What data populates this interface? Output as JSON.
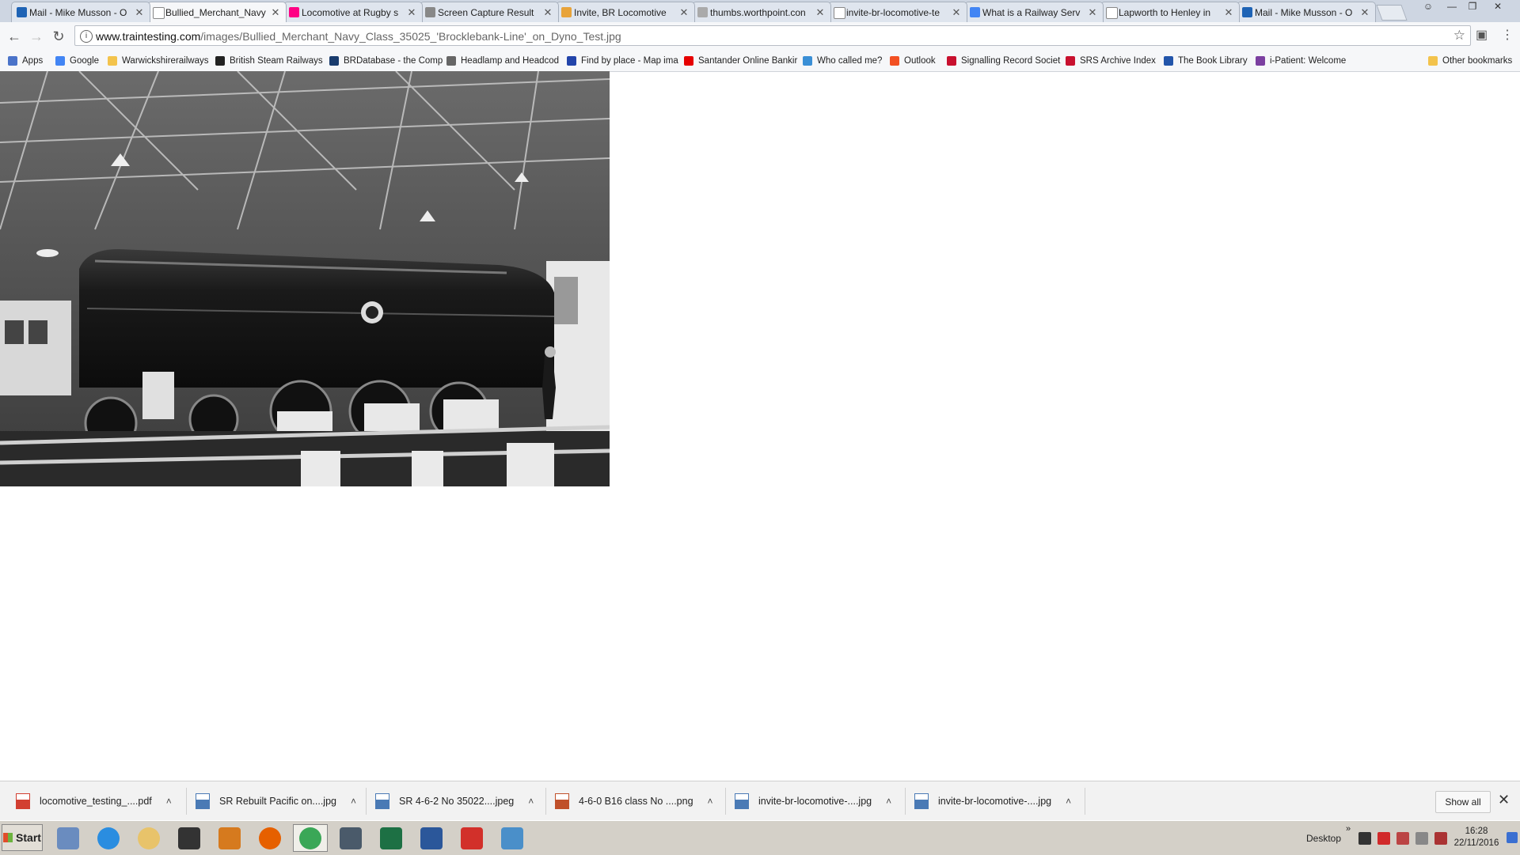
{
  "tabs": [
    {
      "title": "Mail - Mike Musson - O",
      "icon": "outlook-icon",
      "color": "#1e63b5"
    },
    {
      "title": "Bullied_Merchant_Navy",
      "icon": "page-icon",
      "color": "#ffffff",
      "active": true
    },
    {
      "title": "Locomotive at Rugby s",
      "icon": "flickr-icon",
      "color": "#ff0084"
    },
    {
      "title": "Screen Capture Result",
      "icon": "camera-icon",
      "color": "#888888"
    },
    {
      "title": "Invite, BR Locomotive",
      "icon": "site-icon",
      "color": "#e8a33a"
    },
    {
      "title": "thumbs.worthpoint.con",
      "icon": "loading-icon",
      "color": "#aaaaaa"
    },
    {
      "title": "invite-br-locomotive-te",
      "icon": "page-icon",
      "color": "#ffffff"
    },
    {
      "title": "What is a Railway Serv",
      "icon": "google-icon",
      "color": "#4285f4"
    },
    {
      "title": "Lapworth to Henley in",
      "icon": "page-icon",
      "color": "#ffffff"
    },
    {
      "title": "Mail - Mike Musson - O",
      "icon": "outlook-icon",
      "color": "#1e63b5"
    }
  ],
  "toolbar": {
    "url_host": "www.traintesting.com",
    "url_path": "/images/Bullied_Merchant_Navy_Class_35025_'Brocklebank-Line'_on_Dyno_Test.jpg"
  },
  "bookmarks": [
    {
      "label": "Apps",
      "icon": "apps-grid-icon",
      "color": "#4a73c9"
    },
    {
      "label": "Google",
      "icon": "google-icon",
      "color": "#4285f4"
    },
    {
      "label": "Warwickshirerailways",
      "icon": "folder-icon",
      "color": "#f3c34c"
    },
    {
      "label": "British Steam Railways",
      "icon": "bsr-icon",
      "color": "#222222"
    },
    {
      "label": "BRDatabase - the Comp",
      "icon": "brd-icon",
      "color": "#1a3c6e"
    },
    {
      "label": "Headlamp and Headcod",
      "icon": "headlamp-icon",
      "color": "#666666"
    },
    {
      "label": "Find by place - Map ima",
      "icon": "arrow-icon",
      "color": "#2244aa"
    },
    {
      "label": "Santander Online Bankir",
      "icon": "santander-icon",
      "color": "#e60000"
    },
    {
      "label": "Who called me?",
      "icon": "phone-icon",
      "color": "#3a8fd6"
    },
    {
      "label": "Outlook",
      "icon": "windows-icon",
      "color": "#f25022"
    },
    {
      "label": "Signalling Record Societ",
      "icon": "signal-icon",
      "color": "#c8102e"
    },
    {
      "label": "SRS Archive Index",
      "icon": "signal-icon",
      "color": "#c8102e"
    },
    {
      "label": "The Book Library",
      "icon": "book-icon",
      "color": "#2255aa"
    },
    {
      "label": "i-Patient: Welcome",
      "icon": "ipatient-icon",
      "color": "#7b3fa0"
    },
    {
      "label": "Other bookmarks",
      "icon": "folder-icon",
      "color": "#f3c34c"
    }
  ],
  "downloads": [
    {
      "label": "locomotive_testing_....pdf",
      "icon": "pdf-file-icon",
      "color": "#d23f31"
    },
    {
      "label": "SR Rebuilt Pacific on....jpg",
      "icon": "image-file-icon",
      "color": "#4a7ab5"
    },
    {
      "label": "SR 4-6-2 No 35022....jpeg",
      "icon": "image-file-icon",
      "color": "#4a7ab5"
    },
    {
      "label": "4-6-0 B16 class No ....png",
      "icon": "image-file-icon",
      "color": "#c0502a"
    },
    {
      "label": "invite-br-locomotive-....jpg",
      "icon": "image-file-icon",
      "color": "#4a7ab5"
    },
    {
      "label": "invite-br-locomotive-....jpg",
      "icon": "image-file-icon",
      "color": "#4a7ab5"
    }
  ],
  "show_all": "Show all",
  "taskbar": {
    "start": "Start",
    "apps": [
      {
        "icon": "calculator-icon",
        "color": "#6a8cbf"
      },
      {
        "icon": "internet-explorer-icon",
        "color": "#2a8de0"
      },
      {
        "icon": "file-explorer-icon",
        "color": "#e8c36a"
      },
      {
        "icon": "eye-viewer-icon",
        "color": "#333333"
      },
      {
        "icon": "cat-app-icon",
        "color": "#d67a1e"
      },
      {
        "icon": "firefox-icon",
        "color": "#e66000"
      },
      {
        "icon": "chrome-icon",
        "color": "#3aa757",
        "active": true
      },
      {
        "icon": "security-app-icon",
        "color": "#4a5a6a"
      },
      {
        "icon": "excel-icon",
        "color": "#1d7044"
      },
      {
        "icon": "word-icon",
        "color": "#2b579a"
      },
      {
        "icon": "ccleaner-icon",
        "color": "#d2302a"
      },
      {
        "icon": "photo-viewer-icon",
        "color": "#4a8fc9"
      }
    ],
    "desktop_label": "Desktop",
    "time": "16:28",
    "date": "22/11/2016"
  }
}
